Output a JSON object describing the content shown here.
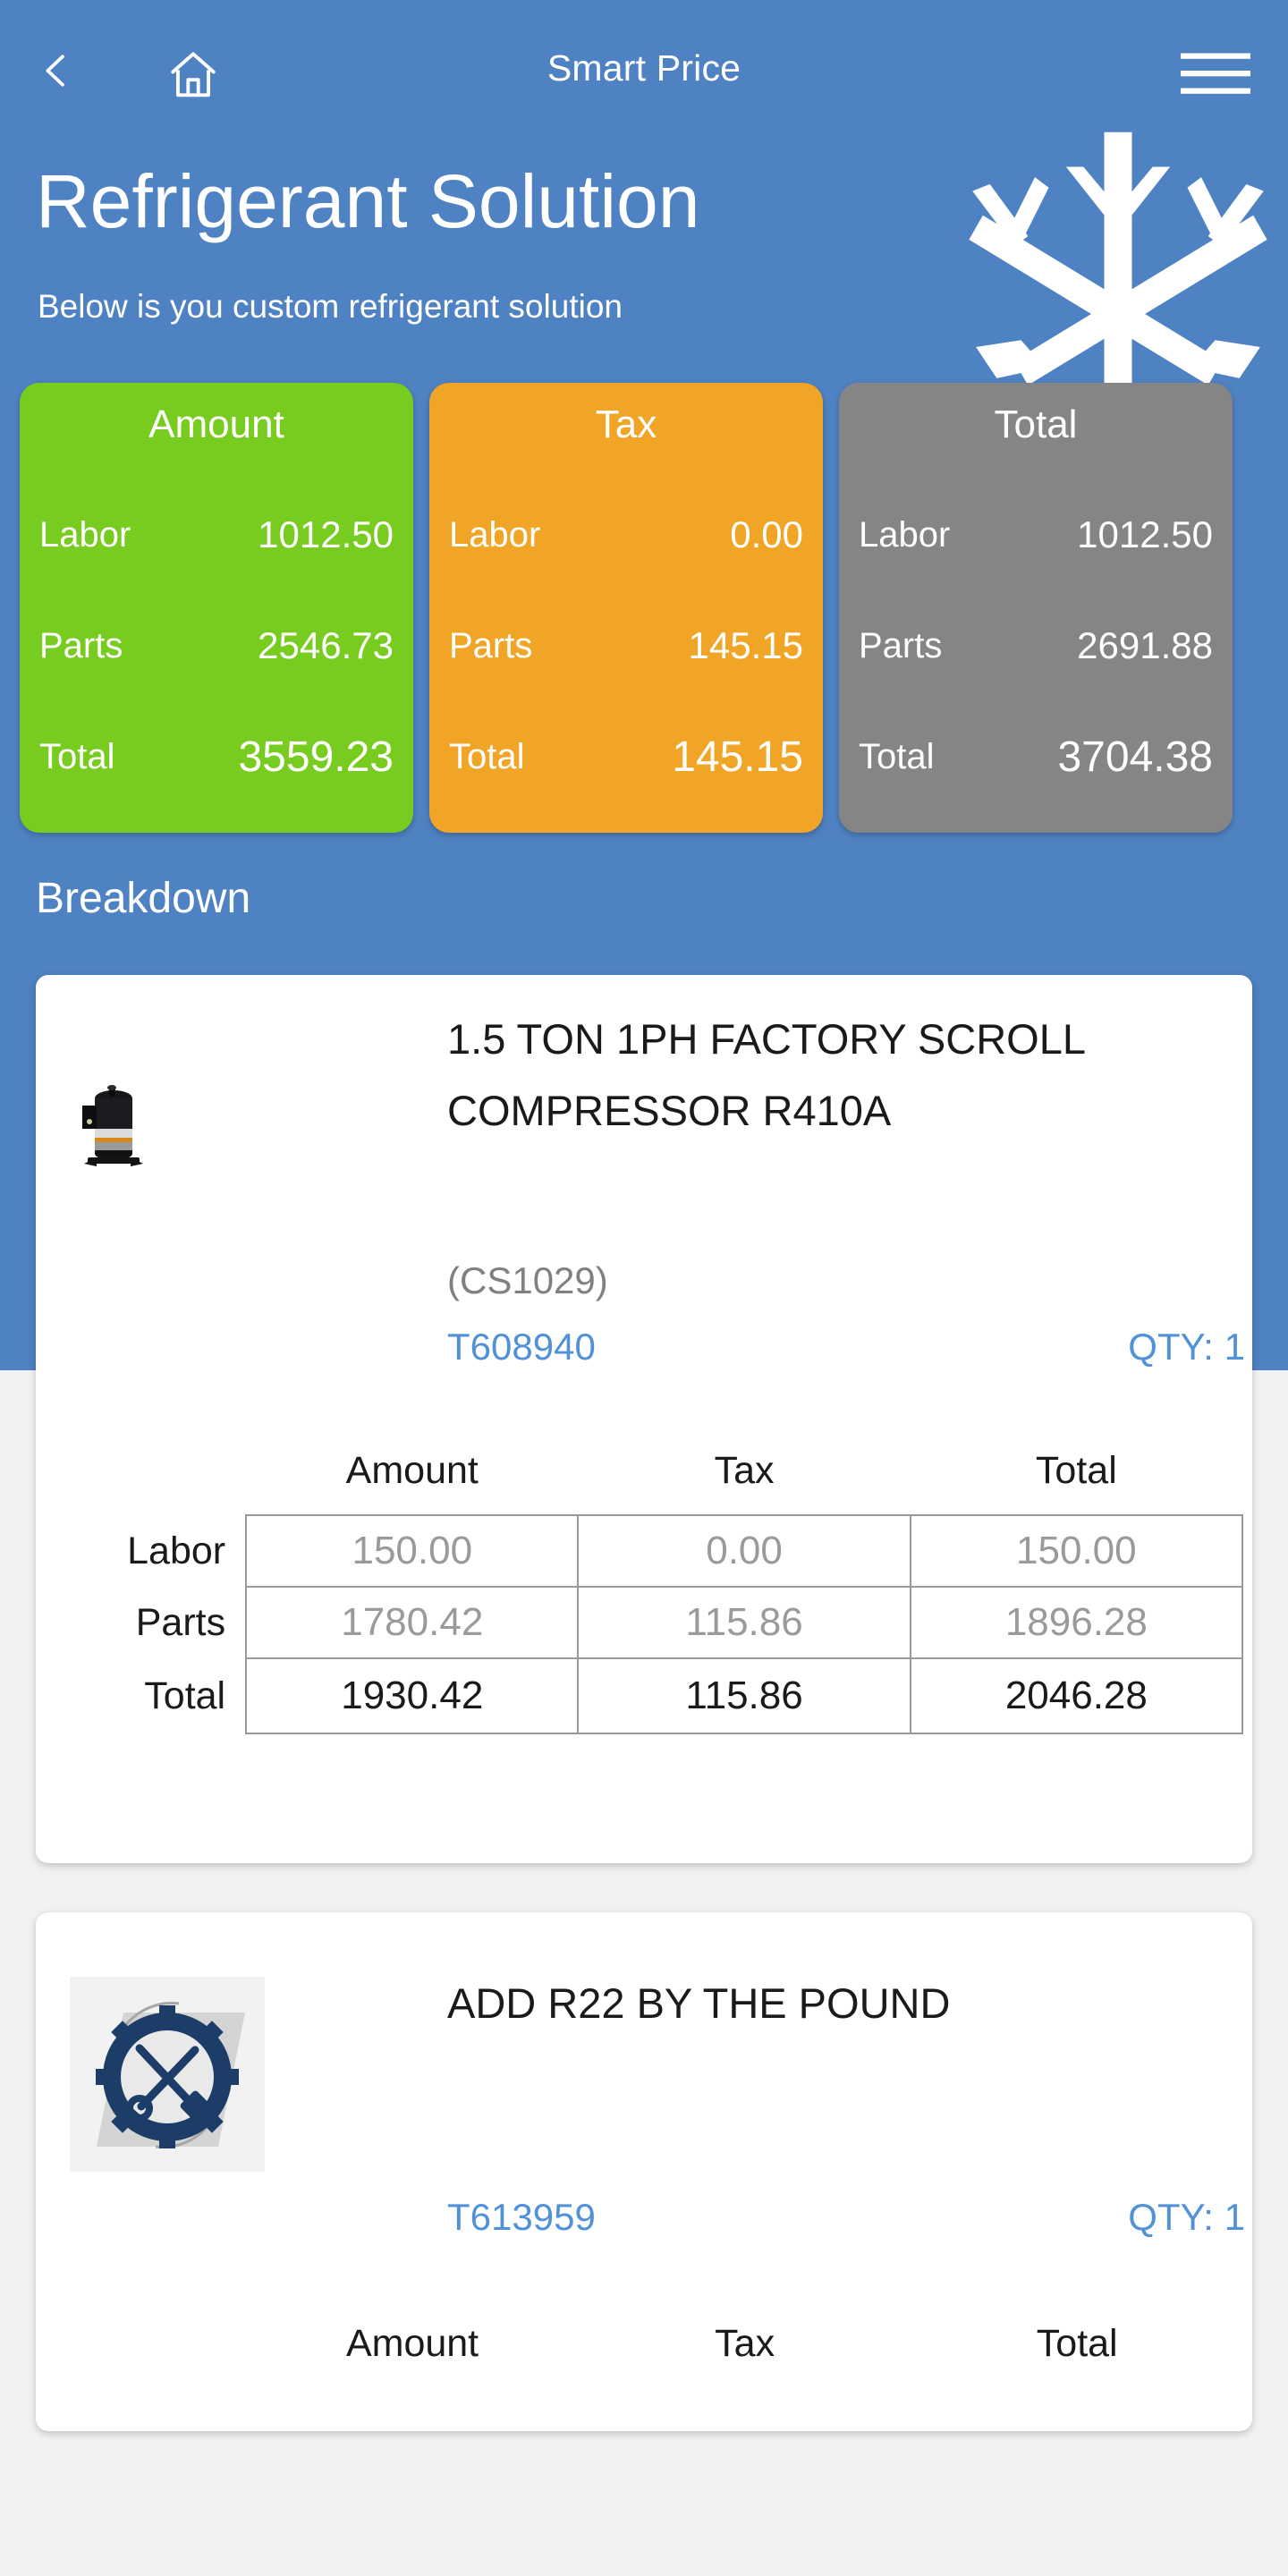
{
  "navbar": {
    "back_icon": "chevron-left-icon",
    "home_icon": "home-icon",
    "menu_icon": "hamburger-menu-icon",
    "title": "Smart Price"
  },
  "hero": {
    "title": "Refrigerant Solution",
    "subtitle": "Below is you custom refrigerant solution",
    "decoration_icon": "snowflake-icon",
    "background_color": "#4f82c2"
  },
  "summary": {
    "row_labels": [
      "Labor",
      "Parts",
      "Total"
    ],
    "cards": [
      {
        "title": "Amount",
        "color": "#77cc1f",
        "values": [
          "1012.50",
          "2546.73",
          "3559.23"
        ]
      },
      {
        "title": "Tax",
        "color": "#f0a526",
        "values": [
          "0.00",
          "145.15",
          "145.15"
        ]
      },
      {
        "title": "Total",
        "color": "#858585",
        "values": [
          "1012.50",
          "2691.88",
          "3704.38"
        ]
      }
    ]
  },
  "breakdown": {
    "heading": "Breakdown",
    "table_headers": [
      "Amount",
      "Tax",
      "Total"
    ],
    "table_row_labels": [
      "Labor",
      "Parts",
      "Total"
    ],
    "items": [
      {
        "title": "1.5 TON 1PH FACTORY SCROLL COMPRESSOR R410A",
        "code": "(CS1029)",
        "part_number": "T608940",
        "qty_label": "QTY: 1",
        "thumb_icon": "scroll-compressor-photo",
        "rows": [
          {
            "label": "Labor",
            "amount": "150.00",
            "tax": "0.00",
            "total": "150.00"
          },
          {
            "label": "Parts",
            "amount": "1780.42",
            "tax": "115.86",
            "total": "1896.28"
          },
          {
            "label": "Total",
            "amount": "1930.42",
            "tax": "115.86",
            "total": "2046.28"
          }
        ]
      },
      {
        "title": "ADD R22 BY THE POUND",
        "code": "",
        "part_number": "T613959",
        "qty_label": "QTY: 1",
        "thumb_icon": "gear-tools-placeholder-icon",
        "rows": []
      }
    ]
  }
}
